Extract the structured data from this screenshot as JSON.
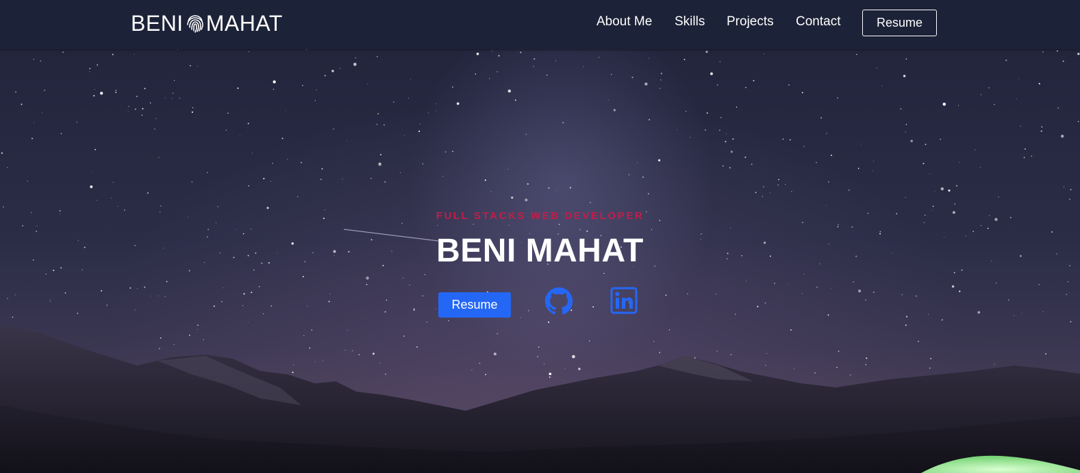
{
  "nav": {
    "brand_first": "BENI",
    "brand_last": "MAHAT",
    "brand_icon": "fingerprint-icon",
    "links": [
      "About Me",
      "Skills",
      "Projects",
      "Contact"
    ],
    "resume_label": "Resume"
  },
  "hero": {
    "subtitle": "FULL STACKS WEB DEVELOPER",
    "title": "BENI MAHAT",
    "resume_label": "Resume",
    "social_icons": [
      "github-icon",
      "linkedin-icon"
    ]
  },
  "colors": {
    "navbar_bg": "#1c2237",
    "accent_blue": "#2567f5",
    "subtitle_red": "#c21d4a"
  }
}
